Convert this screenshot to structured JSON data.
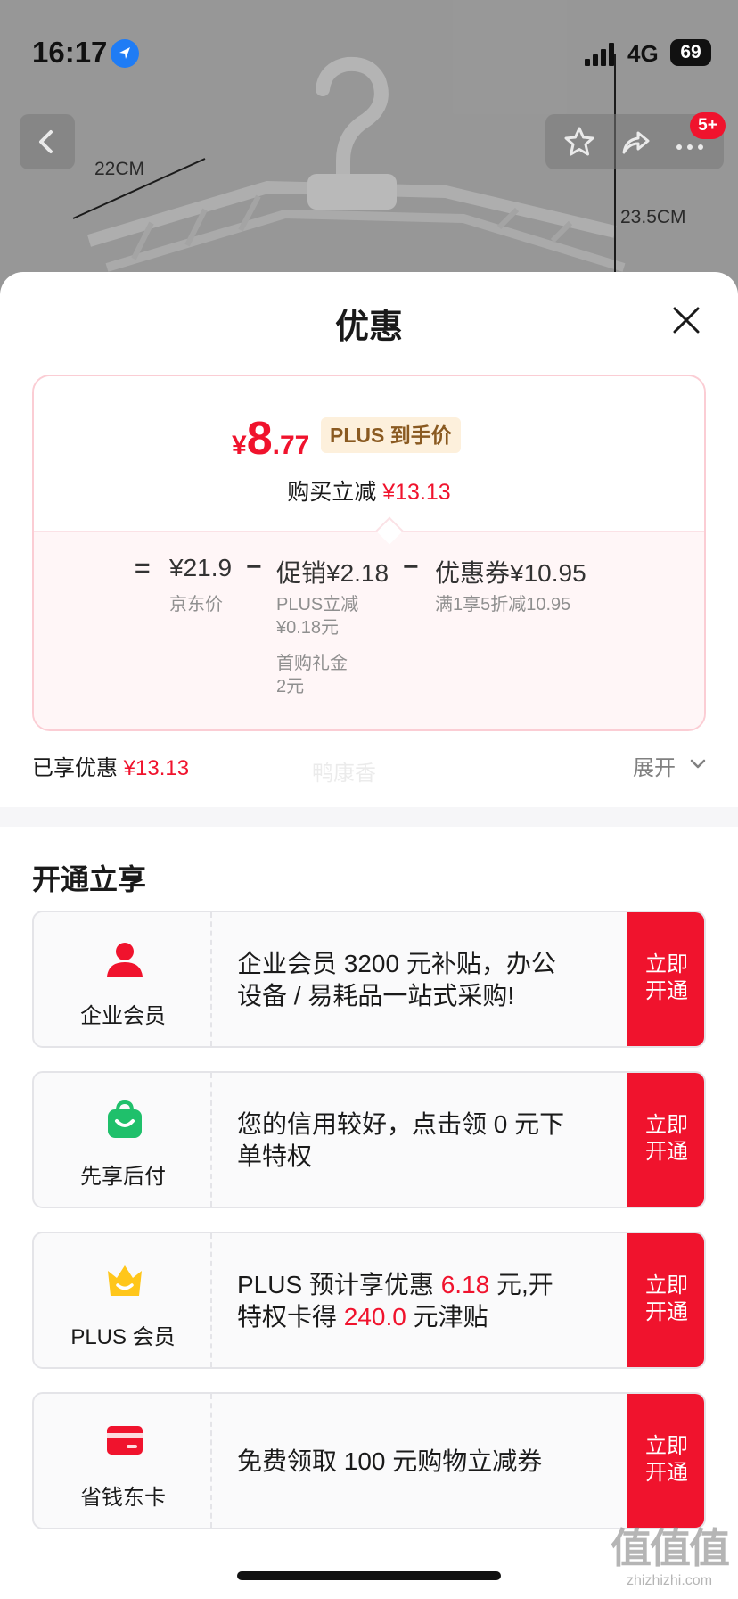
{
  "status_bar": {
    "time": "16:17",
    "network": "4G",
    "battery": "69"
  },
  "product_bg": {
    "width_label": "22CM",
    "height_label": "23.5CM"
  },
  "nav": {
    "badge": "5+"
  },
  "sheet": {
    "title": "优惠",
    "price": {
      "symbol": "¥",
      "integer": "8",
      "decimal": ".77",
      "tag": "PLUS 到手价"
    },
    "buy_reduce": {
      "label": "购买立减",
      "amount": "¥13.13"
    },
    "breakdown": {
      "equals": "=",
      "minus": "−",
      "jd_price": {
        "amount": "¥21.9",
        "label": "京东价"
      },
      "promo": {
        "amount": "促销¥2.18",
        "items": [
          "PLUS立减",
          "¥0.18元",
          "首购礼金",
          "2元"
        ]
      },
      "coupon": {
        "amount": "优惠券¥10.95",
        "desc": "满1享5折减10.95"
      }
    },
    "enjoyed": {
      "label": "已享优惠",
      "amount": "¥13.13"
    },
    "watermark": "鸭康香",
    "expand": "展开"
  },
  "section": {
    "title": "开通立享",
    "cards": [
      {
        "name": "企业会员",
        "desc": "企业会员 3200 元补贴，办公设备 / 易耗品一站式采购!",
        "btn1": "立即",
        "btn2": "开通"
      },
      {
        "name": "先享后付",
        "desc": "您的信用较好，点击领 0 元下单特权",
        "btn1": "立即",
        "btn2": "开通"
      },
      {
        "name": "PLUS 会员",
        "desc_a": "PLUS 预计享优惠 ",
        "hl_1": "6.18",
        "desc_b": " 元,开特权卡得 ",
        "hl_2": "240.0",
        "desc_c": " 元津贴",
        "btn1": "立即",
        "btn2": "开通"
      },
      {
        "name": "省钱东卡",
        "desc": "免费领取 100 元购物立减券",
        "btn1": "立即",
        "btn2": "开通"
      }
    ]
  },
  "site_watermark": {
    "big": "值值值",
    "small": "zhizhizhi.com"
  },
  "colors": {
    "accent": "#f0132d",
    "plus_tag_bg": "#fdf0dc",
    "plus_tag_text": "#8a5a21"
  }
}
